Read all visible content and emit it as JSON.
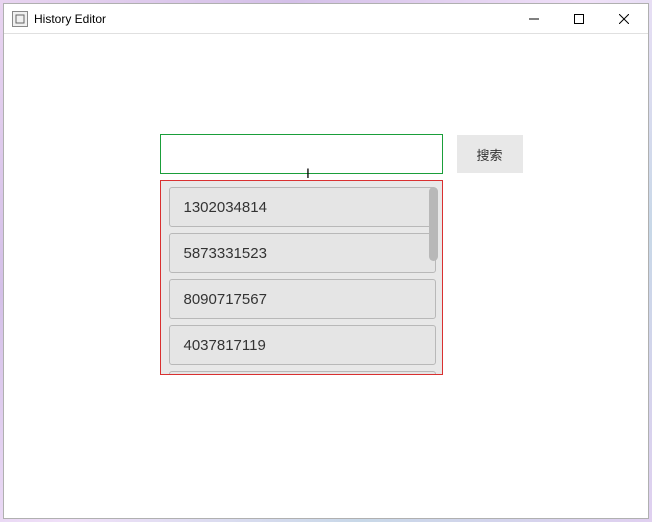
{
  "window": {
    "title": "History Editor"
  },
  "search": {
    "value": "",
    "placeholder": "",
    "button_label": "搜索"
  },
  "list": {
    "items": [
      "1302034814",
      "5873331523",
      "8090717567",
      "4037817119"
    ]
  }
}
